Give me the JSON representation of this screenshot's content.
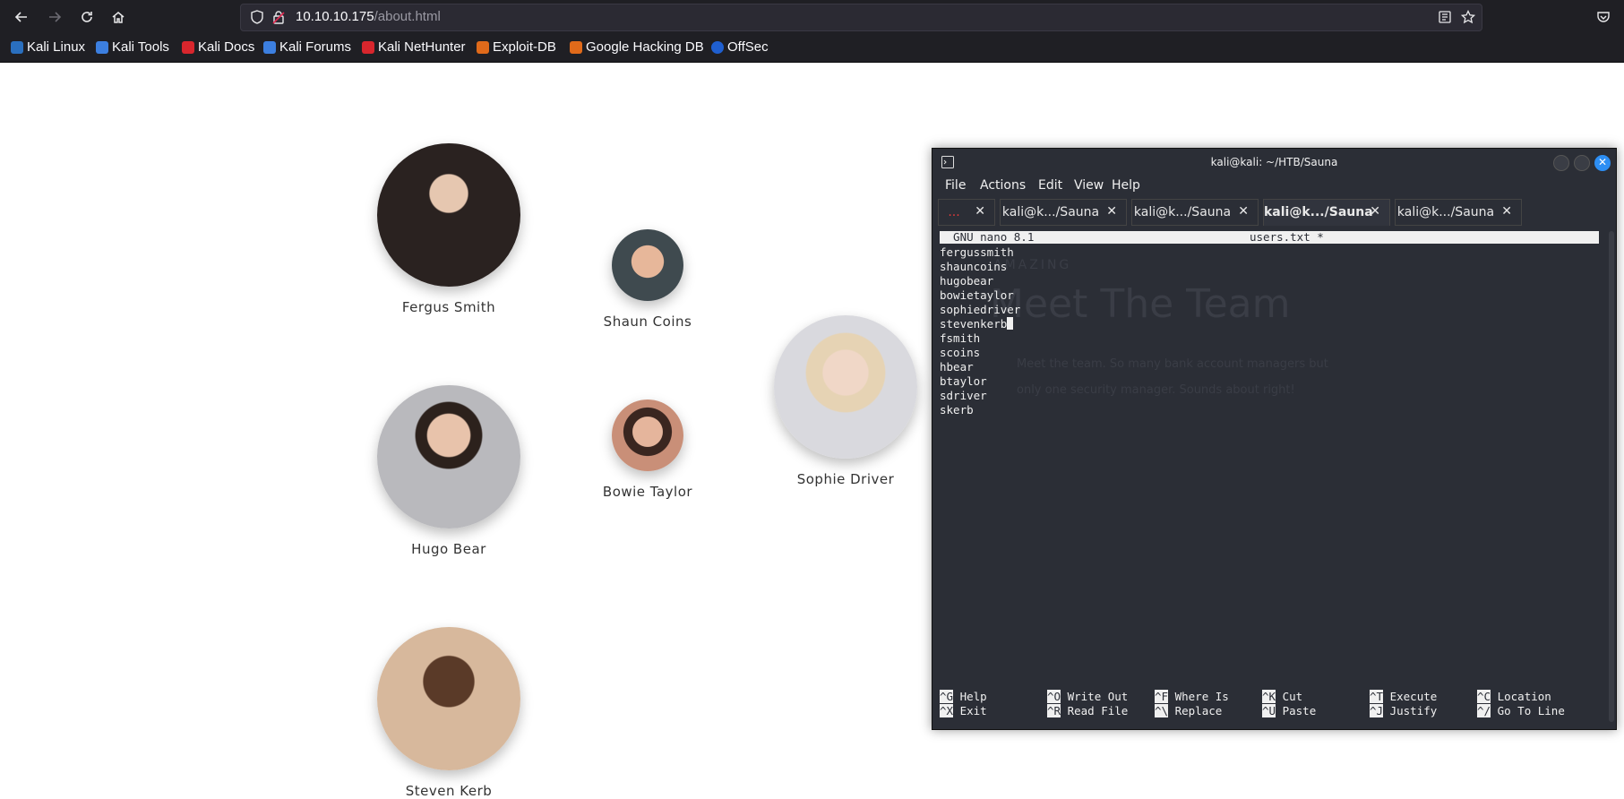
{
  "browser": {
    "url_host": "10.10.10.175",
    "url_path": "/about.html",
    "bookmarks": [
      {
        "label": "Kali Linux",
        "color": "#2a6fbe"
      },
      {
        "label": "Kali Tools",
        "color": "#3c7fe0"
      },
      {
        "label": "Kali Docs",
        "color": "#d8262d"
      },
      {
        "label": "Kali Forums",
        "color": "#3c7fe0"
      },
      {
        "label": "Kali NetHunter",
        "color": "#d8262d"
      },
      {
        "label": "Exploit-DB",
        "color": "#e06a1a"
      },
      {
        "label": "Google Hacking DB",
        "color": "#e06a1a"
      },
      {
        "label": "OffSec",
        "color": "#1f5fd0"
      }
    ]
  },
  "team": {
    "members": [
      {
        "name": "Fergus Smith",
        "skin": "#3b2e2a"
      },
      {
        "name": "Shaun Coins",
        "skin": "#3f4a4f"
      },
      {
        "name": "Sophie Driver",
        "skin": "#d9d9de"
      },
      {
        "name": "Hugo Bear",
        "skin": "#b9b9bd"
      },
      {
        "name": "Bowie Taylor",
        "skin": "#c98f78"
      },
      {
        "name": "Steven Kerb",
        "skin": "#c48a63"
      }
    ],
    "bg_label": "AMAZING",
    "bg_heading": "Meet The Team",
    "bg_text_line1": "Meet the team. So many bank account managers but",
    "bg_text_line2": "only one security manager. Sounds about right!"
  },
  "terminal": {
    "title": "kali@kali: ~/HTB/Sauna",
    "menu": [
      "File",
      "Actions",
      "Edit",
      "View",
      "Help"
    ],
    "tabs": [
      {
        "label": "...",
        "active": false
      },
      {
        "label": "kali@k.../Sauna",
        "active": false
      },
      {
        "label": "kali@k.../Sauna",
        "active": false
      },
      {
        "label": "kali@k.../Sauna",
        "active": true
      },
      {
        "label": "kali@k.../Sauna",
        "active": false
      }
    ],
    "nano_version": "  GNU nano 8.1",
    "nano_file": "users.txt *",
    "lines": [
      "fergussmith",
      "shauncoins",
      "hugobear",
      "bowietaylor",
      "sophiedriver",
      "stevenkerb",
      "fsmith",
      "scoins",
      "hbear",
      "btaylor",
      "sdriver",
      "skerb"
    ],
    "shortcuts": [
      {
        "k1": "^G",
        "l1": "Help",
        "k2": "^X",
        "l2": "Exit"
      },
      {
        "k1": "^O",
        "l1": "Write Out",
        "k2": "^R",
        "l2": "Read File"
      },
      {
        "k1": "^F",
        "l1": "Where Is",
        "k2": "^\\",
        "l2": "Replace"
      },
      {
        "k1": "^K",
        "l1": "Cut",
        "k2": "^U",
        "l2": "Paste"
      },
      {
        "k1": "^T",
        "l1": "Execute",
        "k2": "^J",
        "l2": "Justify"
      },
      {
        "k1": "^C",
        "l1": "Location",
        "k2": "^/",
        "l2": "Go To Line"
      }
    ]
  }
}
